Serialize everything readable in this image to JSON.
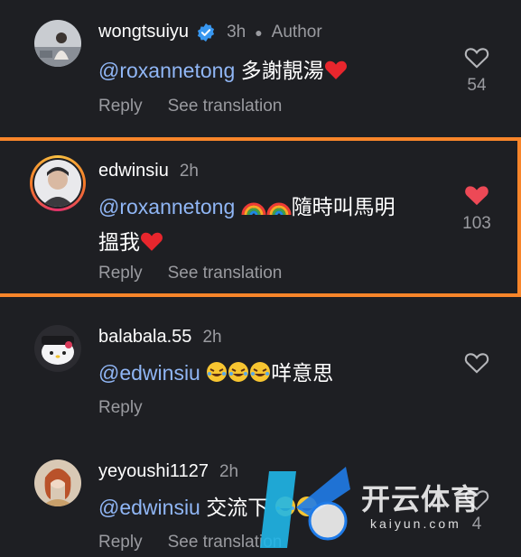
{
  "comments": [
    {
      "username": "wongtsuiyu",
      "verified": true,
      "time": "3h",
      "author_badge": "Author",
      "mention": "@roxannetong",
      "text": " 多謝靚湯",
      "emoji_after": "heart",
      "reply_label": "Reply",
      "translate_label": "See translation",
      "like_count": "54",
      "liked": false
    },
    {
      "username": "edwinsiu",
      "time": "2h",
      "mention": "@roxannetong",
      "text": "隨時叫馬明",
      "text_line2": "搵我",
      "emoji_before": "rainbow-rainbow",
      "emoji_after": "heart",
      "reply_label": "Reply",
      "translate_label": "See translation",
      "like_count": "103",
      "liked": true
    },
    {
      "username": "balabala.55",
      "time": "2h",
      "mention": "@edwinsiu",
      "text": "咩意思",
      "emoji_before": "rofl-rofl-rofl",
      "reply_label": "Reply",
      "like_count": "",
      "liked": false
    },
    {
      "username": "yeyoushi1127",
      "time": "2h",
      "mention": "@edwinsiu",
      "text": " 交流下",
      "emoji_after": "rofl-rofl",
      "reply_label": "Reply",
      "translate_label": "See translation",
      "like_count": "4",
      "liked": false
    }
  ],
  "watermark": {
    "title": "开云体育",
    "subtitle": "kaiyun.com"
  },
  "colors": {
    "background": "#1e1f23",
    "mention": "#90b6f5",
    "highlight": "#f8852a",
    "liked_heart": "#ed4956",
    "muted": "#9a9ba0"
  }
}
